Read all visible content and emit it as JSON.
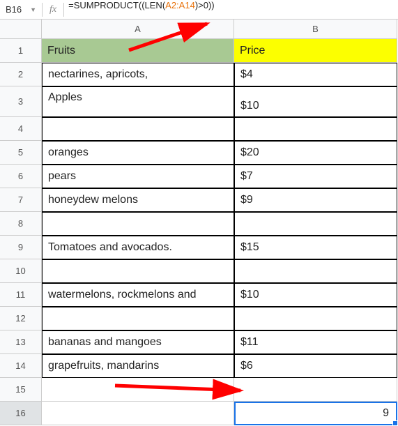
{
  "nameBox": "B16",
  "fxLabel": "fx",
  "formula": {
    "prefix": "=SUMPRODUCT((LEN(",
    "range": "A2:A14",
    "suffix": ")>0))"
  },
  "columns": [
    "A",
    "B"
  ],
  "rows": [
    {
      "num": "1",
      "a": "Fruits",
      "b": "Price",
      "header": true
    },
    {
      "num": "2",
      "a": "nectarines, apricots,",
      "b": "$4"
    },
    {
      "num": "3",
      "a": "Apples",
      "b": "$10",
      "tall": true
    },
    {
      "num": "4",
      "a": "",
      "b": ""
    },
    {
      "num": "5",
      "a": "oranges",
      "b": "$20"
    },
    {
      "num": "6",
      "a": "pears",
      "b": "$7"
    },
    {
      "num": "7",
      "a": "honeydew melons",
      "b": "$9"
    },
    {
      "num": "8",
      "a": "",
      "b": ""
    },
    {
      "num": "9",
      "a": "Tomatoes and avocados.",
      "b": "$15"
    },
    {
      "num": "10",
      "a": "",
      "b": ""
    },
    {
      "num": "11",
      "a": "watermelons, rockmelons and",
      "b": "$10"
    },
    {
      "num": "12",
      "a": "",
      "b": ""
    },
    {
      "num": "13",
      "a": "bananas and mangoes",
      "b": "$11"
    },
    {
      "num": "14",
      "a": "grapefruits, mandarins",
      "b": "$6"
    },
    {
      "num": "15",
      "a": "",
      "b": "",
      "noborder": true
    },
    {
      "num": "16",
      "a": "",
      "b": "9",
      "selected": true,
      "noborder": true
    }
  ]
}
